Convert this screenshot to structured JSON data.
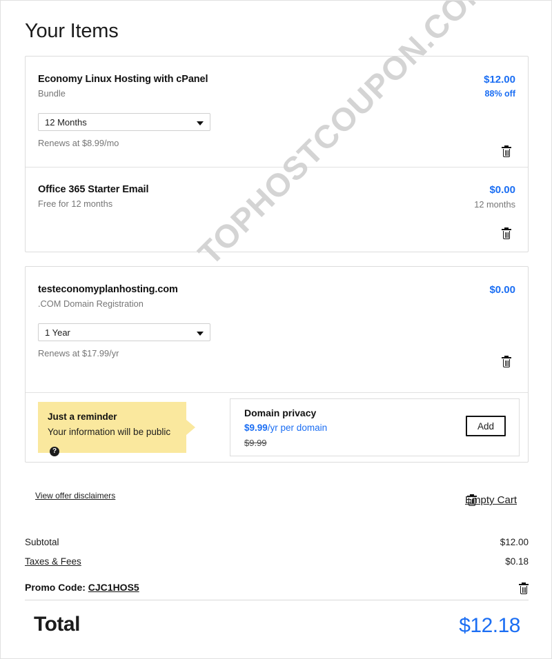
{
  "page": {
    "title": "Your Items",
    "watermark": "TOPHOSTCOUPON.COM",
    "accent_color": "#1b6ef3",
    "reminder_bg": "#fae89e"
  },
  "cards": [
    {
      "items": [
        {
          "name": "Economy Linux Hosting with cPanel",
          "subtitle": "Bundle",
          "term_label": "12 Months",
          "renews": "Renews at $8.99/mo",
          "price": "$12.00",
          "price_note": "88% off",
          "price_note_style": "accent",
          "delete_icon": "trash-icon"
        },
        {
          "name": "Office 365 Starter Email",
          "subtitle": "Free for 12 months",
          "term_label": null,
          "renews": null,
          "price": "$0.00",
          "price_note": "12 months",
          "price_note_style": "muted",
          "delete_icon": "trash-icon"
        }
      ]
    },
    {
      "items": [
        {
          "name": "testeconomyplanhosting.com",
          "subtitle": ".COM Domain Registration",
          "term_label": "1 Year",
          "renews": "Renews at $17.99/yr",
          "price": "$0.00",
          "price_note": null,
          "price_note_style": null,
          "delete_icon": "trash-icon"
        }
      ],
      "privacy": {
        "reminder_title": "Just a reminder",
        "reminder_body": "Your information will be public",
        "help_icon": "question-mark-icon",
        "title": "Domain privacy",
        "price": "$9.99",
        "price_unit": "/yr per domain",
        "strike_price": "$9.99",
        "add_label": "Add"
      }
    }
  ],
  "footer": {
    "disclaimer_link": "View offer disclaimers",
    "empty_cart_label": "Empty Cart",
    "empty_cart_icon": "trash-icon",
    "rows": [
      {
        "label": "Subtotal",
        "value": "$12.00",
        "underline": false
      },
      {
        "label": "Taxes & Fees",
        "value": "$0.18",
        "underline": true
      }
    ],
    "promo_prefix": "Promo Code:",
    "promo_code": "CJC1HOS5",
    "promo_delete_icon": "trash-icon",
    "total_label": "Total",
    "total_value": "$12.18"
  }
}
